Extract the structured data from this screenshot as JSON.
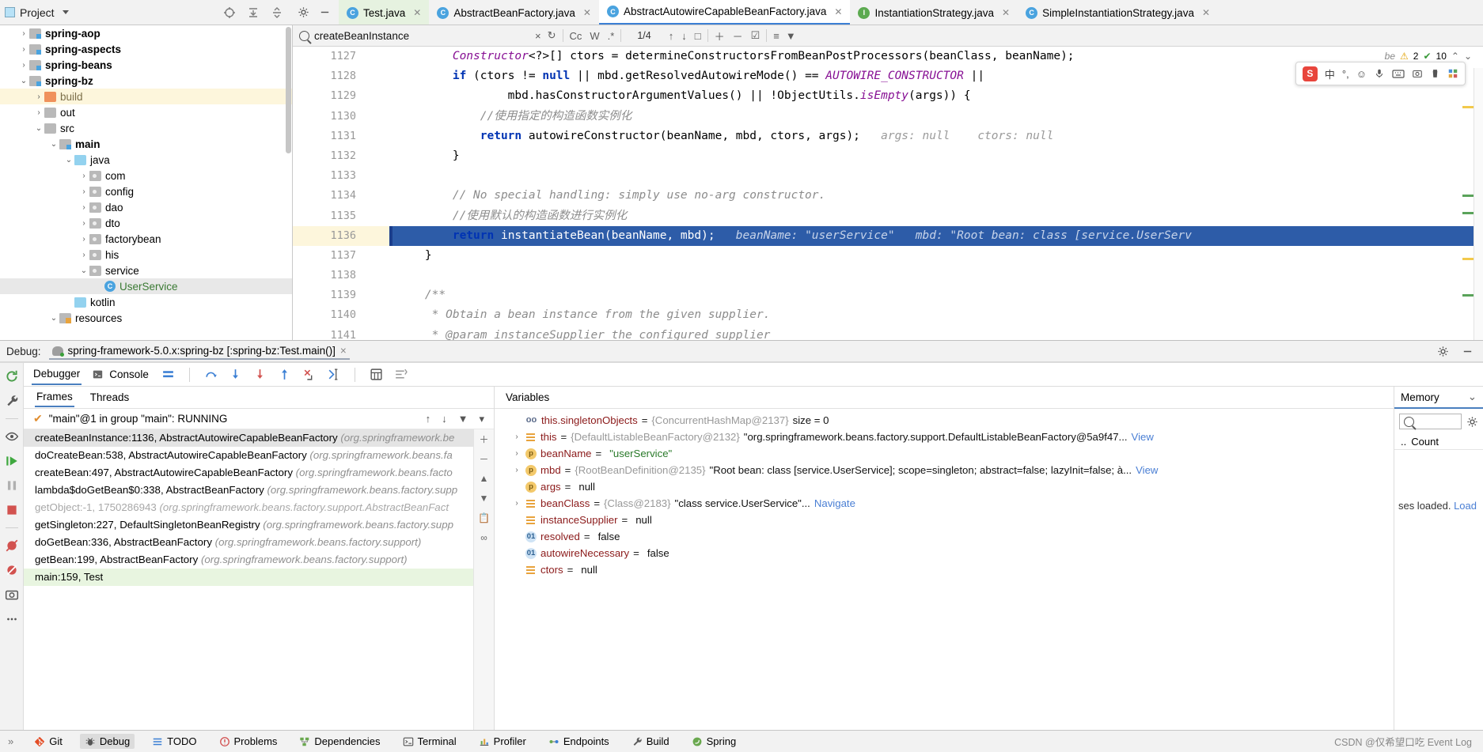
{
  "project_panel": {
    "title": "Project",
    "tools": [
      "locate-icon",
      "collapse-all-icon",
      "expand-icon",
      "settings-icon",
      "hide-icon"
    ],
    "tree": [
      {
        "label": "spring-aop",
        "indent": 1,
        "arrow": "›",
        "icon": "module",
        "bold": true,
        "state": "normal"
      },
      {
        "label": "spring-aspects",
        "indent": 1,
        "arrow": "›",
        "icon": "module",
        "bold": true,
        "state": "normal"
      },
      {
        "label": "spring-beans",
        "indent": 1,
        "arrow": "›",
        "icon": "module",
        "bold": true,
        "state": "normal"
      },
      {
        "label": "spring-bz",
        "indent": 1,
        "arrow": "⌄",
        "icon": "module",
        "bold": true,
        "state": "normal"
      },
      {
        "label": "build",
        "indent": 2,
        "arrow": "›",
        "icon": "orange",
        "bold": false,
        "state": "highlight"
      },
      {
        "label": "out",
        "indent": 2,
        "arrow": "›",
        "icon": "gray",
        "bold": false,
        "state": "normal"
      },
      {
        "label": "src",
        "indent": 2,
        "arrow": "⌄",
        "icon": "gray",
        "bold": false,
        "state": "normal"
      },
      {
        "label": "main",
        "indent": 3,
        "arrow": "⌄",
        "icon": "module",
        "bold": true,
        "state": "normal"
      },
      {
        "label": "java",
        "indent": 4,
        "arrow": "⌄",
        "icon": "blue",
        "bold": false,
        "state": "normal"
      },
      {
        "label": "com",
        "indent": 5,
        "arrow": "›",
        "icon": "pkg",
        "bold": false,
        "state": "normal"
      },
      {
        "label": "config",
        "indent": 5,
        "arrow": "›",
        "icon": "pkg",
        "bold": false,
        "state": "normal"
      },
      {
        "label": "dao",
        "indent": 5,
        "arrow": "›",
        "icon": "pkg",
        "bold": false,
        "state": "normal"
      },
      {
        "label": "dto",
        "indent": 5,
        "arrow": "›",
        "icon": "pkg",
        "bold": false,
        "state": "normal"
      },
      {
        "label": "factorybean",
        "indent": 5,
        "arrow": "›",
        "icon": "pkg",
        "bold": false,
        "state": "normal"
      },
      {
        "label": "his",
        "indent": 5,
        "arrow": "›",
        "icon": "pkg",
        "bold": false,
        "state": "normal"
      },
      {
        "label": "service",
        "indent": 5,
        "arrow": "⌄",
        "icon": "pkg",
        "bold": false,
        "state": "normal"
      },
      {
        "label": "UserService",
        "indent": 6,
        "arrow": "",
        "icon": "class",
        "bold": false,
        "state": "selected"
      },
      {
        "label": "kotlin",
        "indent": 4,
        "arrow": "",
        "icon": "blue",
        "bold": false,
        "state": "normal"
      },
      {
        "label": "resources",
        "indent": 3,
        "arrow": "⌄",
        "icon": "res",
        "bold": false,
        "state": "normal"
      }
    ]
  },
  "editor_tabs": [
    {
      "label": "Test.java",
      "icon": "class-green-run",
      "kind": "c",
      "style": "green"
    },
    {
      "label": "AbstractBeanFactory.java",
      "icon": "class-icon",
      "kind": "c",
      "style": "plain"
    },
    {
      "label": "AbstractAutowireCapableBeanFactory.java",
      "icon": "class-icon",
      "kind": "c",
      "style": "active"
    },
    {
      "label": "InstantiationStrategy.java",
      "icon": "interface-icon",
      "kind": "i",
      "style": "plain"
    },
    {
      "label": "SimpleInstantiationStrategy.java",
      "icon": "class-icon",
      "kind": "c",
      "style": "plain"
    }
  ],
  "find_bar": {
    "query": "createBeanInstance",
    "clear_label": "×",
    "history_label": "↻",
    "match_case_label": "Cc",
    "words_label": "W",
    "regex_label": ".*",
    "counter": "1/4",
    "prev_label": "↑",
    "next_label": "↓",
    "select_all_label": "□",
    "add_label": "＋",
    "remove_label": "－",
    "check_label": "☑",
    "filter_sort_label": "≡",
    "filter_label": "▼"
  },
  "code": {
    "first_line": 1127,
    "current_line": 1136,
    "lines": [
      {
        "n": 1127,
        "fold": "",
        "html": "        <span class=\"cn\">Constructor</span>&lt;?&gt;[] ctors = determineConstructorsFromBeanPostProcessors(beanClass, beanName);"
      },
      {
        "n": 1128,
        "fold": "",
        "html": "        <span class=\"kw\">if</span> (ctors != <span class=\"kw\">null</span> || mbd.getResolvedAutowireMode() == <span class=\"cn\">AUTOWIRE_CONSTRUCTOR</span> ||"
      },
      {
        "n": 1129,
        "fold": "-",
        "html": "                mbd.hasConstructorArgumentValues() || !ObjectUtils.<span class=\"cn\">isEmpty</span>(args)) {"
      },
      {
        "n": 1130,
        "fold": "",
        "html": "            <span class=\"cm\">//使用指定的构造函数实例化</span>"
      },
      {
        "n": 1131,
        "fold": "",
        "html": "            <span class=\"kw\">return</span> autowireConstructor(beanName, mbd, ctors, args);   <span class=\"hint\">args: null    ctors: null</span>"
      },
      {
        "n": 1132,
        "fold": "-",
        "html": "        }"
      },
      {
        "n": 1133,
        "fold": "",
        "html": ""
      },
      {
        "n": 1134,
        "fold": "-",
        "html": "        <span class=\"cm\">// No special handling: simply use no-arg constructor.</span>"
      },
      {
        "n": 1135,
        "fold": "-",
        "html": "        <span class=\"cm\">//使用默认的构造函数进行实例化</span>"
      },
      {
        "n": 1136,
        "fold": "",
        "html": "        <span class=\"kw\">return</span> instantiateBean(beanName, mbd);   <span class=\"hint\">beanName: \"userService\"   mbd: \"Root bean: class [service.UserServ</span>"
      },
      {
        "n": 1137,
        "fold": "-",
        "html": "    }"
      },
      {
        "n": 1138,
        "fold": "",
        "html": ""
      },
      {
        "n": 1139,
        "fold": "-",
        "html": "    <span class=\"cm\">/**</span>"
      },
      {
        "n": 1140,
        "fold": "",
        "html": "     <span class=\"cm\">* Obtain a bean instance from the given supplier.</span>"
      },
      {
        "n": 1141,
        "fold": "",
        "html": "     <span class=\"cm\">* @param instanceSupplier the configured supplier</span>"
      }
    ]
  },
  "inspections": {
    "warning_count": "2",
    "ok_count": "10",
    "up_label": "⌃",
    "down_label": "⌄"
  },
  "ime_toolbar": {
    "logo_label": "S",
    "items": [
      "中",
      "°,",
      "☺",
      "mic-icon",
      "keyboard-icon",
      "screenshot-icon",
      "trash-icon",
      "grid-icon"
    ]
  },
  "debug_header": {
    "label": "Debug:",
    "config_name": "spring-framework-5.0.x:spring-bz [:spring-bz:Test.main()]",
    "close_label": "×",
    "settings_icon": "gear-icon",
    "minimize_icon": "minimize-icon"
  },
  "debug_toolbar": {
    "tabs": [
      {
        "label": "Debugger",
        "active": true
      },
      {
        "label": "Console",
        "active": false
      }
    ],
    "icons": [
      "layout-icon",
      "step-over-icon",
      "step-into-icon",
      "force-step-into-icon",
      "step-out-icon",
      "drop-frame-icon",
      "run-to-cursor-icon",
      "evaluate-icon",
      "settings2-icon"
    ]
  },
  "left_rail": [
    "rerun-icon",
    "wrench-icon",
    "eye-icon",
    "resume-icon",
    "pause-icon",
    "stop-icon",
    "mute-breakpoints-icon",
    "breakpoints-icon",
    "camera-icon",
    "more-icon"
  ],
  "frames_panel": {
    "tabs": [
      {
        "label": "Frames",
        "active": true
      },
      {
        "label": "Threads",
        "active": false
      }
    ],
    "thread": "\"main\"@1 in group \"main\": RUNNING",
    "thread_icons": [
      "up-icon",
      "down-icon",
      "filter-icon",
      "dropdown-icon"
    ],
    "rail_icons": [
      "plus-icon",
      "minus-icon",
      "up-arrow-icon",
      "down-arrow-icon",
      "copy-icon",
      "link-icon"
    ],
    "frames": [
      {
        "method": "createBeanInstance:1136, AbstractAutowireCapableBeanFactory ",
        "pkg": "(org.springframework.be",
        "state": "selected"
      },
      {
        "method": "doCreateBean:538, AbstractAutowireCapableBeanFactory ",
        "pkg": "(org.springframework.beans.fa",
        "state": "normal"
      },
      {
        "method": "createBean:497, AbstractAutowireCapableBeanFactory ",
        "pkg": "(org.springframework.beans.facto",
        "state": "normal"
      },
      {
        "method": "lambda$doGetBean$0:338, AbstractBeanFactory ",
        "pkg": "(org.springframework.beans.factory.supp",
        "state": "normal"
      },
      {
        "method": "getObject:-1, 1750286943 ",
        "pkg": "(org.springframework.beans.factory.support.AbstractBeanFact",
        "state": "dim"
      },
      {
        "method": "getSingleton:227, DefaultSingletonBeanRegistry ",
        "pkg": "(org.springframework.beans.factory.supp",
        "state": "normal"
      },
      {
        "method": "doGetBean:336, AbstractBeanFactory ",
        "pkg": "(org.springframework.beans.factory.support)",
        "state": "normal"
      },
      {
        "method": "getBean:199, AbstractBeanFactory ",
        "pkg": "(org.springframework.beans.factory.support)",
        "state": "normal"
      },
      {
        "method": "main:159, Test ",
        "pkg": "",
        "state": "green"
      }
    ]
  },
  "variables_panel": {
    "header": "Variables",
    "rows": [
      {
        "expand": "",
        "badge": "oo",
        "badge_kind": "none",
        "name": "this.singletonObjects",
        "eq": " = ",
        "ref": "{ConcurrentHashMap@2137}",
        "value": " size = 0",
        "value_kind": "plain",
        "link": ""
      },
      {
        "expand": "›",
        "badge": "",
        "badge_kind": "lines",
        "name": "this",
        "eq": " = ",
        "ref": "{DefaultListableBeanFactory@2132}",
        "value": " \"org.springframework.beans.factory.support.DefaultListableBeanFactory@5a9f47...",
        "value_kind": "plain",
        "link": " View"
      },
      {
        "expand": "›",
        "badge": "p",
        "badge_kind": "param",
        "name": "beanName",
        "eq": " = ",
        "ref": "",
        "value": "\"userService\"",
        "value_kind": "string",
        "link": ""
      },
      {
        "expand": "›",
        "badge": "p",
        "badge_kind": "param",
        "name": "mbd",
        "eq": " = ",
        "ref": "{RootBeanDefinition@2135}",
        "value": " \"Root bean: class [service.UserService]; scope=singleton; abstract=false; lazyInit=false; à...",
        "value_kind": "plain",
        "link": " View"
      },
      {
        "expand": "",
        "badge": "p",
        "badge_kind": "param",
        "name": "args",
        "eq": " = ",
        "ref": "",
        "value": "null",
        "value_kind": "plain",
        "link": ""
      },
      {
        "expand": "›",
        "badge": "",
        "badge_kind": "lines",
        "name": "beanClass",
        "eq": " = ",
        "ref": "{Class@2183}",
        "value": " \"class service.UserService\"...",
        "value_kind": "plain",
        "link": " Navigate"
      },
      {
        "expand": "",
        "badge": "",
        "badge_kind": "lines",
        "name": "instanceSupplier",
        "eq": " = ",
        "ref": "",
        "value": "null",
        "value_kind": "plain",
        "link": ""
      },
      {
        "expand": "",
        "badge": "01",
        "badge_kind": "blue",
        "name": "resolved",
        "eq": " = ",
        "ref": "",
        "value": "false",
        "value_kind": "plain",
        "link": ""
      },
      {
        "expand": "",
        "badge": "01",
        "badge_kind": "blue",
        "name": "autowireNecessary",
        "eq": " = ",
        "ref": "",
        "value": "false",
        "value_kind": "plain",
        "link": ""
      },
      {
        "expand": "",
        "badge": "",
        "badge_kind": "lines",
        "name": "ctors",
        "eq": " = ",
        "ref": "",
        "value": "null",
        "value_kind": "plain",
        "link": ""
      }
    ]
  },
  "memory_panel": {
    "title": "Memory",
    "collapse_label": "⌄",
    "search_icon": "search-icon",
    "settings_icon": "gear-icon",
    "column_sort": "..",
    "column_name": "Count",
    "note_text": "ses loaded. ",
    "note_link": "Load"
  },
  "status_bar": {
    "items": [
      {
        "label": "Git",
        "icon": "git-icon",
        "active": false
      },
      {
        "label": "Debug",
        "icon": "debug-icon",
        "active": true
      },
      {
        "label": "TODO",
        "icon": "todo-icon",
        "active": false
      },
      {
        "label": "Problems",
        "icon": "problems-icon",
        "active": false
      },
      {
        "label": "Dependencies",
        "icon": "dependencies-icon",
        "active": false
      },
      {
        "label": "Terminal",
        "icon": "terminal-icon",
        "active": false
      },
      {
        "label": "Profiler",
        "icon": "profiler-icon",
        "active": false
      },
      {
        "label": "Endpoints",
        "icon": "endpoints-icon",
        "active": false
      },
      {
        "label": "Build",
        "icon": "build-icon",
        "active": false
      },
      {
        "label": "Spring",
        "icon": "spring-icon",
        "active": false
      }
    ],
    "expand_label": "»",
    "watermark": "CSDN @仅希望口吃  Event Log"
  }
}
